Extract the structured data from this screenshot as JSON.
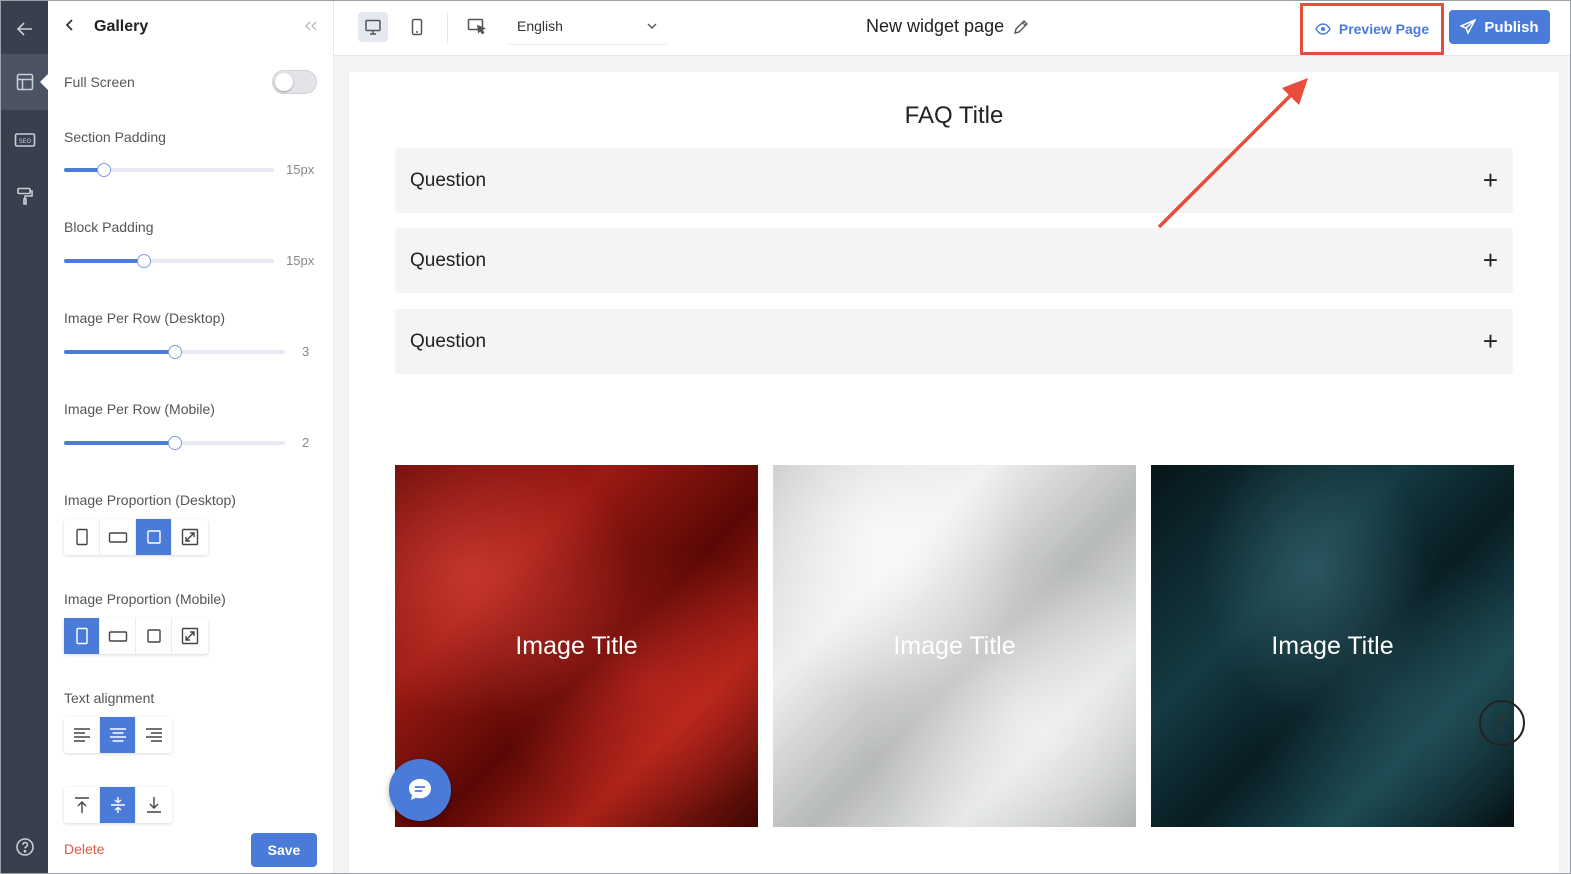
{
  "panel": {
    "title": "Gallery",
    "full_screen_label": "Full Screen",
    "full_screen_on": false,
    "section_padding": {
      "label": "Section Padding",
      "value_text": "15px",
      "fraction": 0.19
    },
    "block_padding": {
      "label": "Block Padding",
      "value_text": "15px",
      "fraction": 0.38
    },
    "per_row_desktop": {
      "label": "Image Per Row (Desktop)",
      "value_text": "3",
      "fraction": 0.5
    },
    "per_row_mobile": {
      "label": "Image Per Row (Mobile)",
      "value_text": "2",
      "fraction": 0.5
    },
    "proportion_desktop_label": "Image Proportion (Desktop)",
    "proportion_mobile_label": "Image Proportion (Mobile)",
    "text_alignment_label": "Text alignment",
    "delete_label": "Delete",
    "save_label": "Save"
  },
  "topbar": {
    "language": "English",
    "page_title": "New widget page",
    "preview_label": "Preview Page",
    "publish_label": "Publish"
  },
  "canvas": {
    "faq_title": "FAQ Title",
    "questions": [
      "Question",
      "Question",
      "Question"
    ],
    "image_titles": [
      "Image Title",
      "Image Title",
      "Image Title"
    ]
  },
  "colors": {
    "accent": "#4b7bd8",
    "highlight": "#e74c3c",
    "rail": "#39404d"
  }
}
